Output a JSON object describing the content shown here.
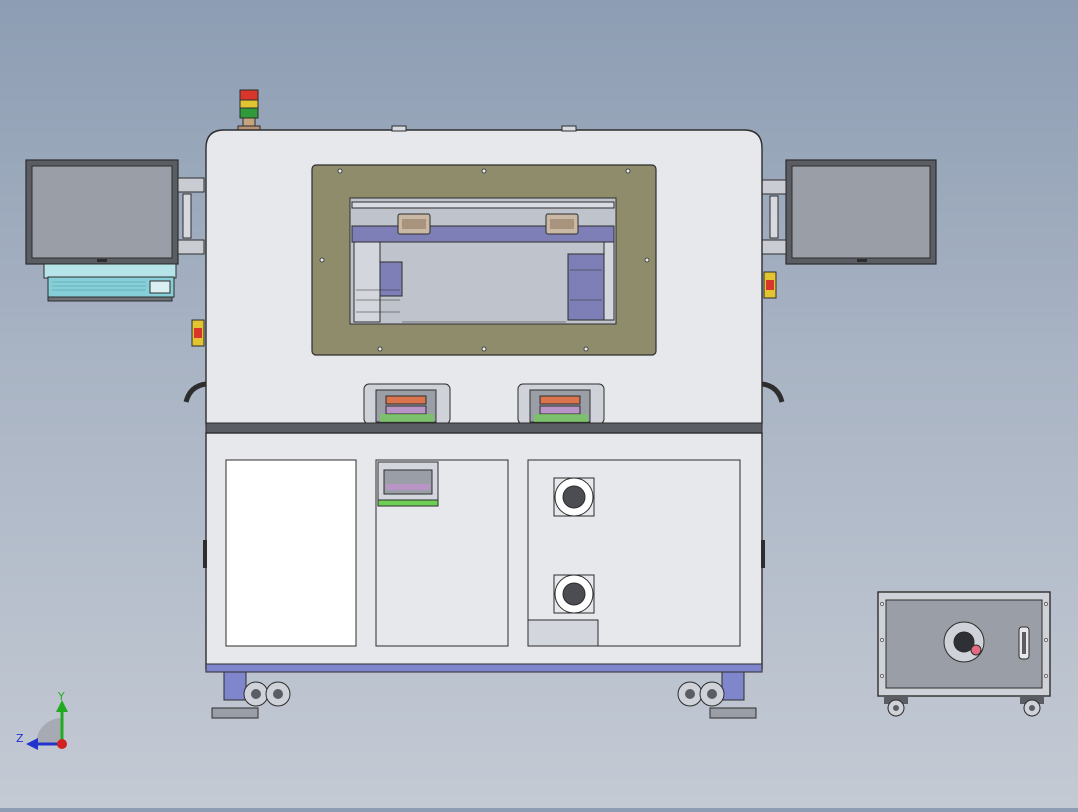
{
  "scene": {
    "name": "cad-assembly-front-view",
    "background_top": "#8d9db3",
    "background_bottom": "#c4cad4"
  },
  "palette": {
    "body": "#e6e8ec",
    "outline": "#2d2d2d",
    "window_frame": "#8f8c6c",
    "machine_purple": "#7e7fb6",
    "screen": "#9a9ea6",
    "foot_blue": "#7f86cc",
    "keyboard": "#86cfd8",
    "tower_red": "#d8362a",
    "tower_yellow": "#e2c431",
    "tower_green": "#2f9a3a",
    "accent_pink": "#e46a82",
    "terminal_green": "#6fcf55",
    "triad_x": "#d32020",
    "triad_y": "#22aa22",
    "triad_z": "#2233cc"
  },
  "triad": {
    "y_label": "Y",
    "z_label": "Z"
  }
}
